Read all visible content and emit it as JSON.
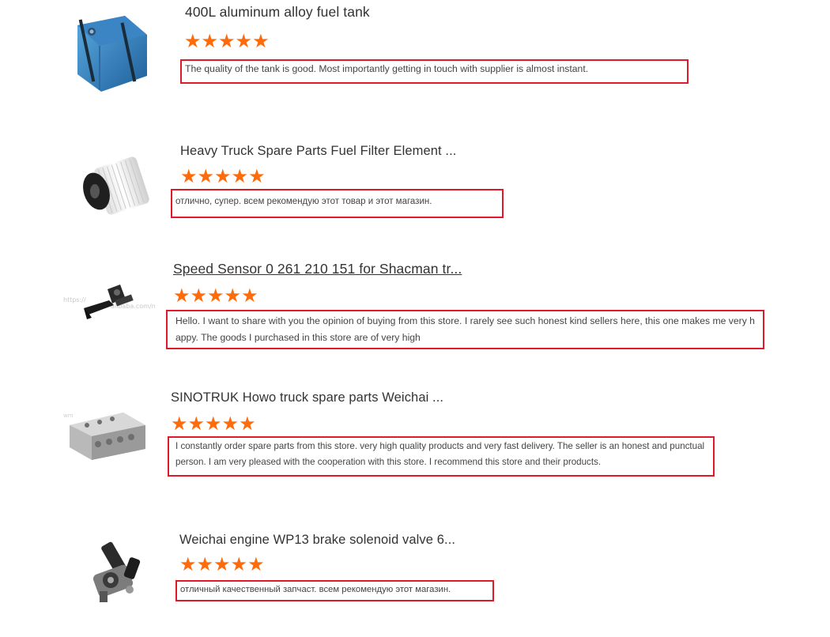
{
  "accent_star_color": "#ff6a0a",
  "highlight_border_color": "#e01a2b",
  "reviews": [
    {
      "product": "400L aluminum alloy fuel tank",
      "thumbnail_icon": "fuel-tank-image",
      "rating": 5,
      "review_text": "The quality of the tank is good. Most importantly getting in touch with supplier is almost instant."
    },
    {
      "product": "Heavy Truck Spare Parts Fuel Filter Element ...",
      "thumbnail_icon": "fuel-filter-image",
      "rating": 5,
      "review_text": "отлично, супер. всем рекомендую этот товар и этот магазин."
    },
    {
      "product": "Speed Sensor 0 261 210 151 for Shacman tr...",
      "thumbnail_icon": "speed-sensor-image",
      "thumbnail_watermark": "https://...en.alibaba.com/...",
      "rating": 5,
      "review_text": "Hello.  I want to share with you the opinion of buying from this store.  I rarely see such honest kind sellers here, this one makes me very happy.  The goods I purchased in this store are of very high"
    },
    {
      "product": "SINOTRUK Howo truck spare parts Weichai ...",
      "thumbnail_icon": "cylinder-head-image",
      "rating": 5,
      "review_text": "I constantly order spare parts from this store.  very high quality products and very fast delivery.  The seller is an honest and punctual person.  I am very pleased with the cooperation with this store.  I recommend this store and their products."
    },
    {
      "product": "Weichai engine WP13 brake solenoid valve 6...",
      "thumbnail_icon": "solenoid-valve-image",
      "rating": 5,
      "review_text": "отличный качественный запчаст. всем рекомендую этот магазин."
    }
  ],
  "star_glyph": "★"
}
